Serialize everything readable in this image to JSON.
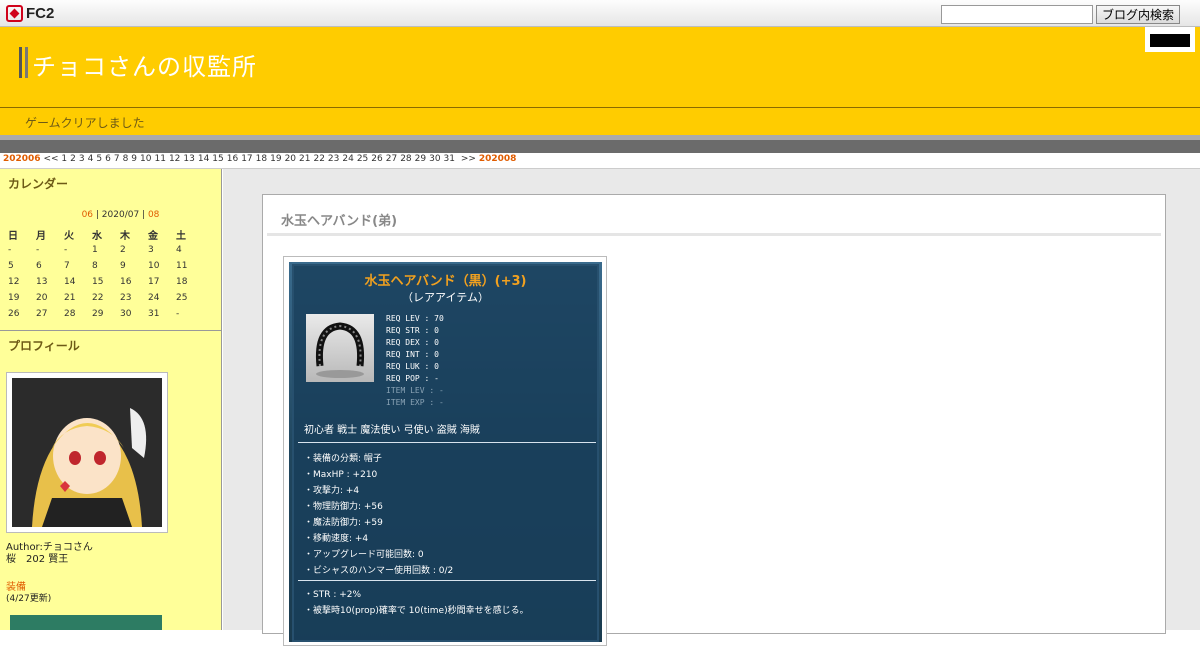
{
  "fc2": {
    "logo": "FC2",
    "search_placeholder": "",
    "search_button": "ブログ内検索"
  },
  "header": {
    "title": "チョコさんの収監所",
    "description": "ゲームクリアしました"
  },
  "datebar": {
    "prev": "202006",
    "prev_arrow": "<<",
    "days": [
      "1",
      "2",
      "3",
      "4",
      "5",
      "6",
      "7",
      "8",
      "9",
      "10",
      "11",
      "12",
      "13",
      "14",
      "15",
      "16",
      "17",
      "18",
      "19",
      "20",
      "21",
      "22",
      "23",
      "24",
      "25",
      "26",
      "27",
      "28",
      "29",
      "30",
      "31"
    ],
    "next_arrow": ">>",
    "next": "202008"
  },
  "sidebar": {
    "calendar_heading": "カレンダー",
    "cal_prev": "06",
    "cal_current": "2020/07",
    "cal_next": "08",
    "weekdays": [
      "日",
      "月",
      "火",
      "水",
      "木",
      "金",
      "土"
    ],
    "weeks": [
      [
        "-",
        "-",
        "-",
        "1",
        "2",
        "3",
        "4"
      ],
      [
        "5",
        "6",
        "7",
        "8",
        "9",
        "10",
        "11"
      ],
      [
        "12",
        "13",
        "14",
        "15",
        "16",
        "17",
        "18"
      ],
      [
        "19",
        "20",
        "21",
        "22",
        "23",
        "24",
        "25"
      ],
      [
        "26",
        "27",
        "28",
        "29",
        "30",
        "31",
        "-"
      ]
    ],
    "profile_heading": "プロフィール",
    "author_line1": "Author:チョコさん",
    "author_line2": "桜　202 賢王",
    "equip_link": "装備",
    "equip_note": "(4/27更新)"
  },
  "entry": {
    "title": "水玉ヘアバンド(弟)",
    "item": {
      "name": "水玉ヘアバンド（黒）(+3)",
      "rarity": "（レアアイテム）",
      "stats": [
        "REQ LEV : 70",
        "REQ STR : 0",
        "REQ DEX : 0",
        "REQ INT : 0",
        "REQ LUK : 0",
        "REQ POP : -"
      ],
      "stats_dim": [
        "ITEM LEV : -",
        "ITEM EXP : -"
      ],
      "jobs": "初心者 戦士 魔法使い 弓使い 盗賊 海賊",
      "props": [
        "・装備の分類: 帽子",
        "・MaxHP : +210",
        "・攻撃力: +4",
        "・物理防御力: +56",
        "・魔法防御力: +59",
        "・移動速度: +4",
        "・アップグレード可能回数: 0",
        "・ビシャスのハンマー使用回数 : 0/2"
      ],
      "props2": [
        "・STR : +2%",
        "・被撃時10(prop)確率で 10(time)秒間幸せを感じる。"
      ]
    }
  },
  "colors": {
    "header": "#ffcc00",
    "sidebar": "#ffff99",
    "accent": "#e05c00"
  }
}
